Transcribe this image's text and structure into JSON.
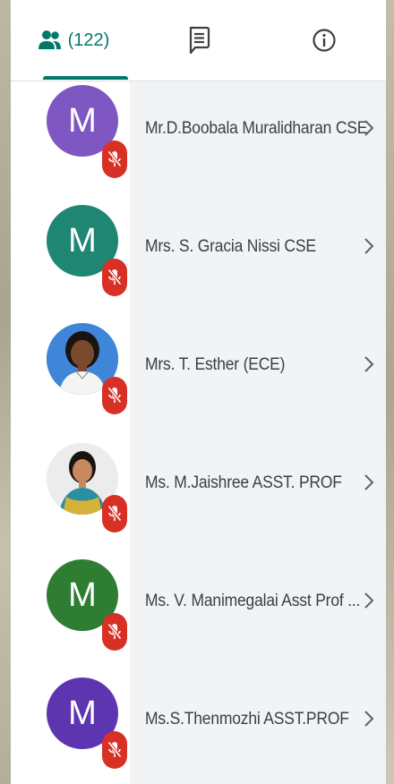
{
  "tabs": {
    "people_count": "(122)"
  },
  "participants": [
    {
      "initial": "M",
      "name": "Mr.D.Boobala Muralidharan CSE",
      "avatar_color": "#7e57c2",
      "avatar_type": "letter"
    },
    {
      "initial": "M",
      "name": "Mrs. S. Gracia Nissi CSE",
      "avatar_color": "#1e8673",
      "avatar_type": "letter"
    },
    {
      "initial": "",
      "name": "Mrs. T. Esther (ECE)",
      "avatar_color": "#3a7bd5",
      "avatar_type": "photo"
    },
    {
      "initial": "",
      "name": "Ms. M.Jaishree ASST. PROF",
      "avatar_color": "#e9e9e9",
      "avatar_type": "photo"
    },
    {
      "initial": "M",
      "name": "Ms. V. Manimegalai Asst Prof ...",
      "avatar_color": "#2e7d32",
      "avatar_type": "letter"
    },
    {
      "initial": "M",
      "name": "Ms.S.Thenmozhi ASST.PROF",
      "avatar_color": "#5e35b1",
      "avatar_type": "letter"
    }
  ],
  "colors": {
    "accent": "#00796b",
    "mic_muted": "#d93025",
    "panel_bg": "#f1f3f4"
  },
  "icons": {
    "people_tab": "people-icon",
    "chat_tab": "chat-icon",
    "info_tab": "info-icon",
    "mic_off": "mic-off-icon",
    "chevron": "chevron-right-icon"
  }
}
